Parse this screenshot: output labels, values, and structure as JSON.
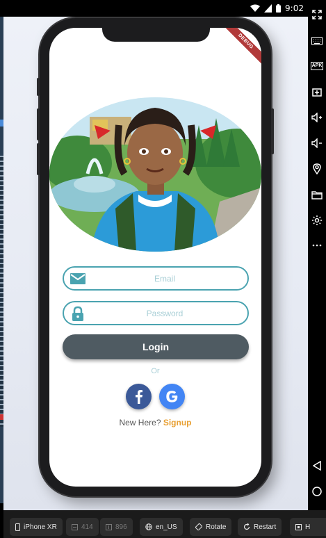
{
  "status_bar": {
    "time": "9:02"
  },
  "app": {
    "debug_banner": "DEBUG",
    "email_placeholder": "Email",
    "password_placeholder": "Password",
    "login_label": "Login",
    "or_label": "Or",
    "new_here_label": "New Here?",
    "signup_label": "Signup"
  },
  "colors": {
    "field_border": "#4aa3b0",
    "login_button": "#4f5b62",
    "facebook": "#3b5998",
    "google": "#4285f4",
    "signup_link": "#e8a033"
  },
  "side_toolbar": {
    "apk_label": "APK",
    "icons": [
      "fullscreen-icon",
      "keyboard-icon",
      "apk-icon",
      "screenshot-icon",
      "volume-up-icon",
      "volume-down-icon",
      "location-icon",
      "folder-icon",
      "settings-icon",
      "more-icon",
      "back-icon",
      "home-icon",
      "recents-icon"
    ]
  },
  "bottom_toolbar": {
    "device": "iPhone XR",
    "width": "414",
    "height": "896",
    "locale": "en_US",
    "rotate": "Rotate",
    "restart": "Restart",
    "last": "H"
  }
}
